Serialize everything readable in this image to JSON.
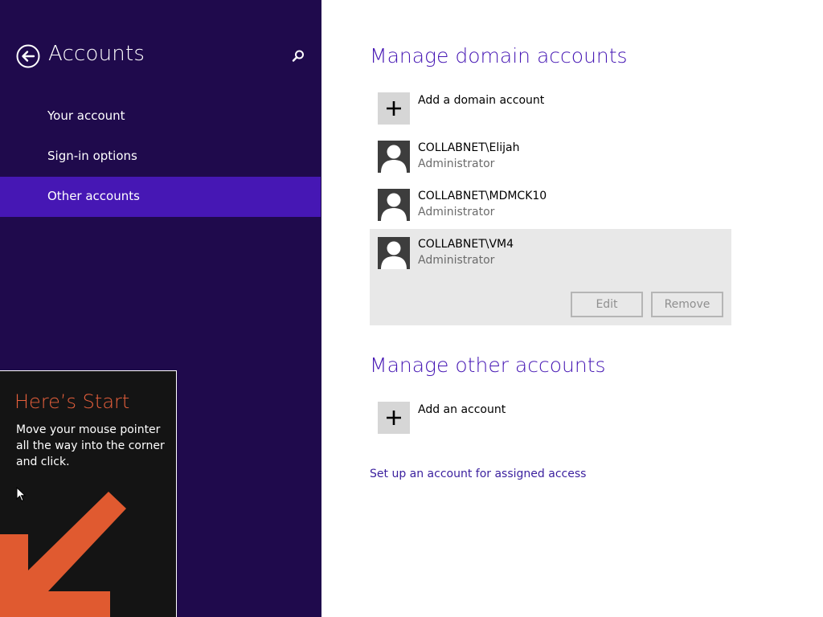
{
  "sidebar": {
    "title": "Accounts",
    "items": [
      {
        "label": "Your account"
      },
      {
        "label": "Sign-in options"
      },
      {
        "label": "Other accounts"
      }
    ]
  },
  "domain_section": {
    "title": "Manage domain accounts",
    "add_label": "Add a domain account",
    "accounts": [
      {
        "name": "COLLABNET\\Elijah",
        "role": "Administrator"
      },
      {
        "name": "COLLABNET\\MDMCK10",
        "role": "Administrator"
      },
      {
        "name": "COLLABNET\\VM4",
        "role": "Administrator"
      }
    ],
    "edit_label": "Edit",
    "remove_label": "Remove"
  },
  "other_section": {
    "title": "Manage other accounts",
    "add_label": "Add an account"
  },
  "assigned_access_link": "Set up an account for assigned access",
  "start_tip": {
    "title": "Here’s Start",
    "body": "Move your mouse pointer all the way into the corner and click."
  },
  "colors": {
    "sidebar_bg": "#1f0a4c",
    "selected_nav": "#4617b4",
    "accent": "#4617b4",
    "tip_title": "#e8603c",
    "tip_arrow": "#e05a30"
  },
  "icons": {
    "back": "back-arrow-circle-icon",
    "search": "search-icon",
    "add": "plus-icon",
    "user": "user-avatar-icon",
    "cursor": "mouse-pointer-icon",
    "arrow": "down-left-arrow-icon"
  }
}
